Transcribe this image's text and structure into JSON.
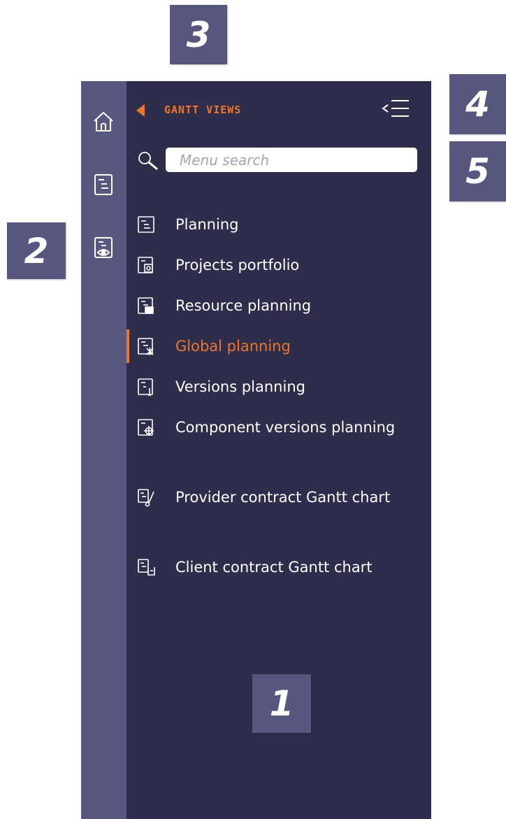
{
  "callouts": {
    "c1": "1",
    "c2": "2",
    "c3": "3",
    "c4": "4",
    "c5": "5"
  },
  "header": {
    "title": "GANTT VIEWS"
  },
  "search": {
    "placeholder": "Menu search"
  },
  "rail": {
    "items": [
      {
        "icon": "home-icon"
      },
      {
        "icon": "gantt-view-icon"
      },
      {
        "icon": "gantt-view-eye-icon"
      }
    ]
  },
  "menu": {
    "items": [
      {
        "label": "Planning",
        "icon": "planning-icon",
        "active": false
      },
      {
        "label": "Projects portfolio",
        "icon": "projects-portfolio-icon",
        "active": false
      },
      {
        "label": "Resource planning",
        "icon": "resource-planning-icon",
        "active": false
      },
      {
        "label": "Global planning",
        "icon": "global-planning-icon",
        "active": true
      },
      {
        "label": "Versions planning",
        "icon": "versions-planning-icon",
        "active": false
      },
      {
        "label": "Component versions planning",
        "icon": "component-versions-icon",
        "active": false
      },
      {
        "label": "Provider contract Gantt chart",
        "icon": "provider-contract-icon",
        "active": false
      },
      {
        "label": "Client contract Gantt chart",
        "icon": "client-contract-icon",
        "active": false
      }
    ]
  },
  "colors": {
    "rail": "#58577f",
    "panel": "#2e2d4c",
    "accent": "#e9772e",
    "badge": "#56567e",
    "text": "#ffffff"
  }
}
